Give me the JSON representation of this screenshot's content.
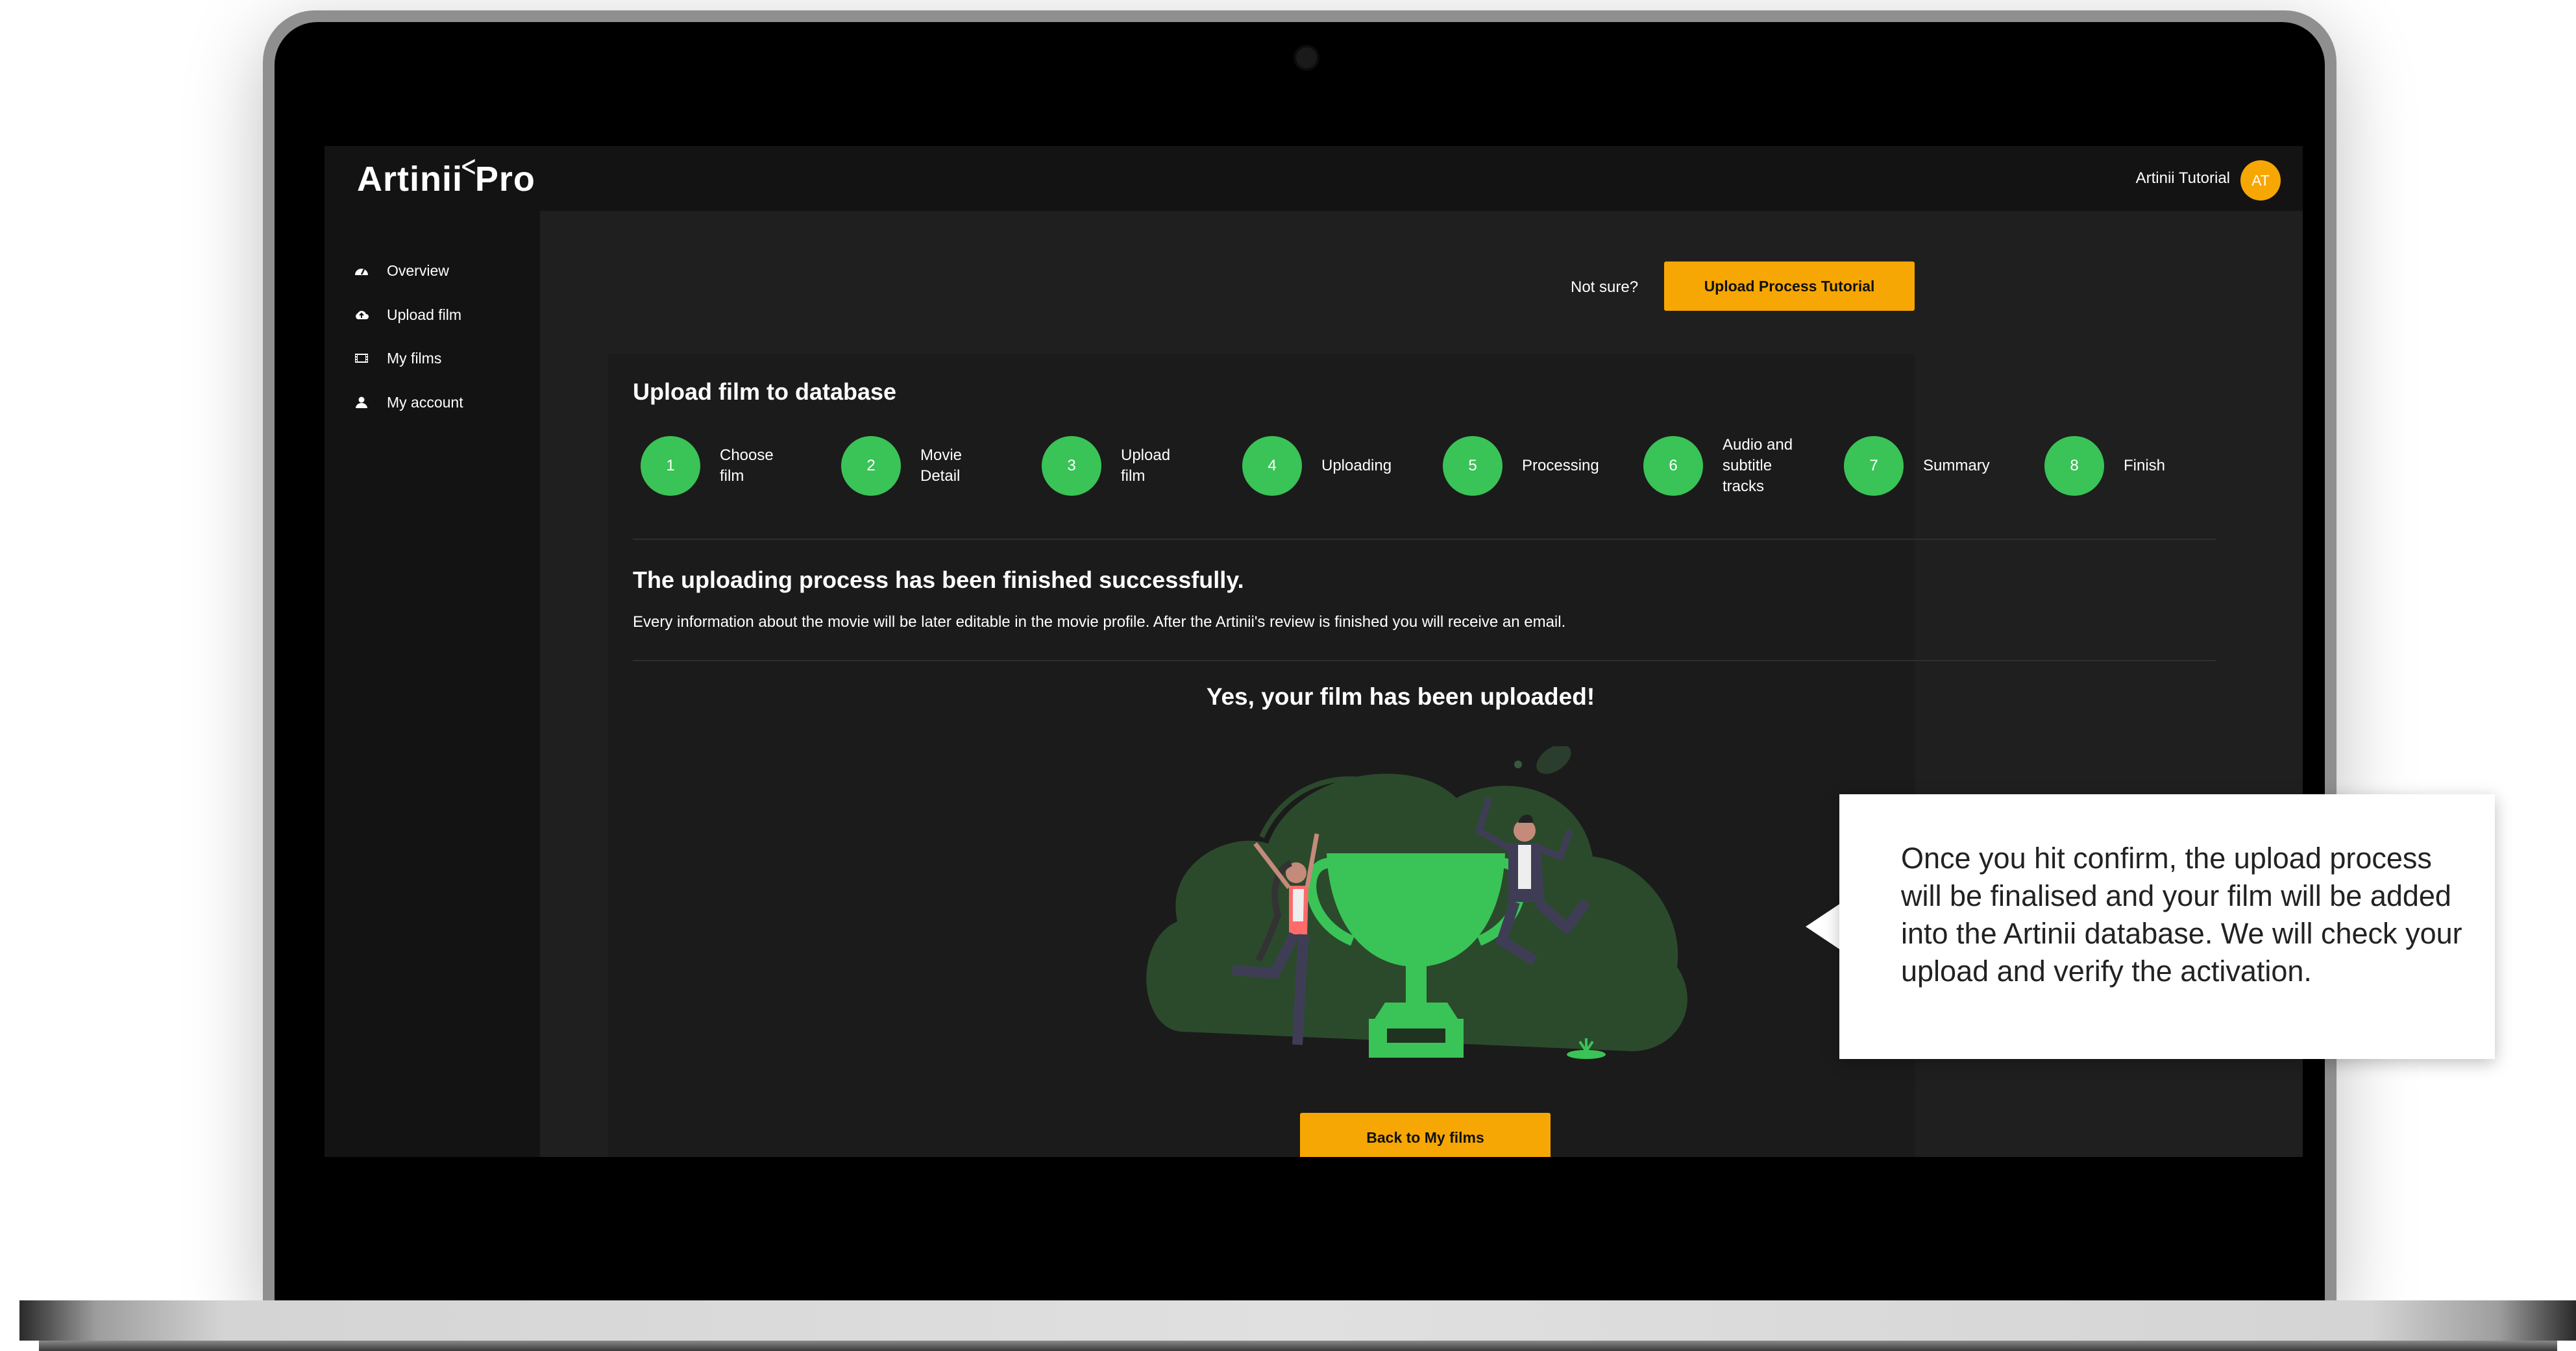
{
  "header": {
    "logo_text_left": "Artinii",
    "logo_text_right": "Pro",
    "user_name": "Artinii Tutorial",
    "avatar_initials": "AT"
  },
  "sidebar": {
    "items": [
      {
        "label": "Overview",
        "icon": "dashboard-icon"
      },
      {
        "label": "Upload film",
        "icon": "cloud-upload-icon"
      },
      {
        "label": "My films",
        "icon": "film-icon"
      },
      {
        "label": "My account",
        "icon": "user-icon"
      }
    ]
  },
  "toolbar": {
    "not_sure_text": "Not sure?",
    "tutorial_button": "Upload Process Tutorial"
  },
  "panel": {
    "title": "Upload film to database",
    "steps": [
      {
        "number": "1",
        "label": "Choose film"
      },
      {
        "number": "2",
        "label": "Movie Detail"
      },
      {
        "number": "3",
        "label": "Upload film"
      },
      {
        "number": "4",
        "label": "Uploading"
      },
      {
        "number": "5",
        "label": "Processing"
      },
      {
        "number": "6",
        "label": "Audio and subtitle tracks"
      },
      {
        "number": "7",
        "label": "Summary"
      },
      {
        "number": "8",
        "label": "Finish"
      }
    ],
    "success_title": "The uploading process has been finished successfully.",
    "success_text": "Every information about the movie will be later editable in the movie profile. After the Artinii's review is finished you will receive an email.",
    "uploaded_title": "Yes, your film has been uploaded!",
    "back_button": "Back to My films"
  },
  "callout": {
    "text": "Once you hit confirm, the upload process will be finalised and your film will be added into the Artinii database. We will check your upload and verify the activation."
  },
  "colors": {
    "accent": "#f7a703",
    "step_green": "#3ac357",
    "background": "#1f1f1f"
  }
}
